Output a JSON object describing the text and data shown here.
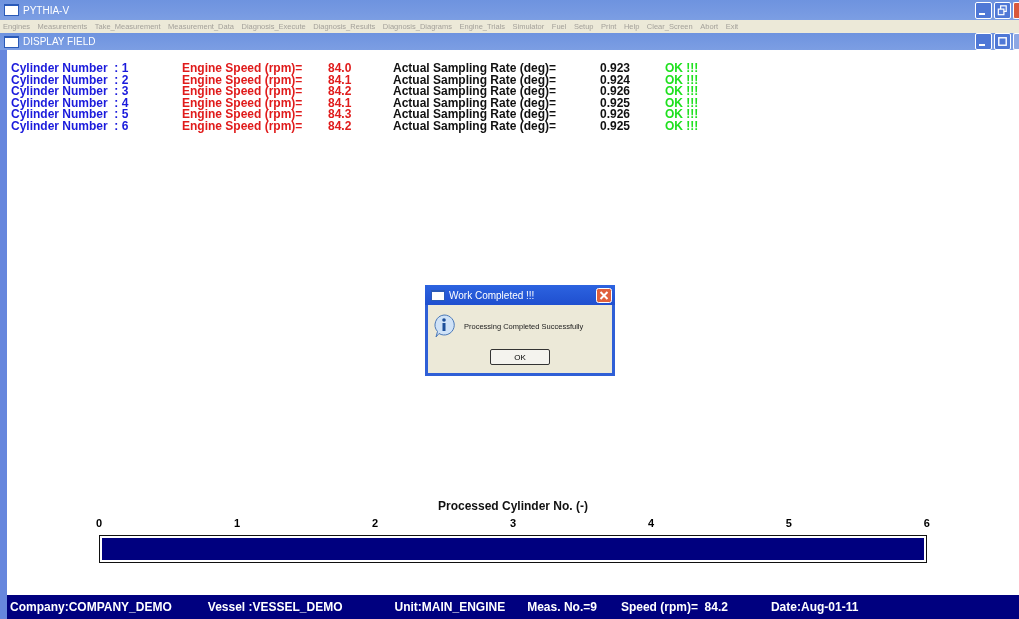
{
  "window": {
    "title": "PYTHIA-V"
  },
  "menu": [
    "Engines",
    "Measurements",
    "Take_Measurement",
    "Measurement_Data",
    "Diagnosis_Execute",
    "Diagnosis_Results",
    "Diagnosis_Diagrams",
    "Engine_Trials",
    "Simulator",
    "Fuel",
    "Setup",
    "Print",
    "Help",
    "Clear_Screen",
    "Abort",
    "Exit"
  ],
  "child_window": {
    "title": "DISPLAY FIELD"
  },
  "rows": [
    {
      "cylinder": "Cylinder Number  : 1",
      "speed_label": "Engine Speed (rpm)=",
      "speed": "84.0",
      "rate_label": "Actual Sampling Rate (deg)=",
      "rate": "0.923",
      "status": "OK !!!"
    },
    {
      "cylinder": "Cylinder Number  : 2",
      "speed_label": "Engine Speed (rpm)=",
      "speed": "84.1",
      "rate_label": "Actual Sampling Rate (deg)=",
      "rate": "0.924",
      "status": "OK !!!"
    },
    {
      "cylinder": "Cylinder Number  : 3",
      "speed_label": "Engine Speed (rpm)=",
      "speed": "84.2",
      "rate_label": "Actual Sampling Rate (deg)=",
      "rate": "0.926",
      "status": "OK !!!"
    },
    {
      "cylinder": "Cylinder Number  : 4",
      "speed_label": "Engine Speed (rpm)=",
      "speed": "84.1",
      "rate_label": "Actual Sampling Rate (deg)=",
      "rate": "0.925",
      "status": "OK !!!"
    },
    {
      "cylinder": "Cylinder Number  : 5",
      "speed_label": "Engine Speed (rpm)=",
      "speed": "84.3",
      "rate_label": "Actual Sampling Rate (deg)=",
      "rate": "0.926",
      "status": "OK !!!"
    },
    {
      "cylinder": "Cylinder Number  : 6",
      "speed_label": "Engine Speed (rpm)=",
      "speed": "84.2",
      "rate_label": "Actual Sampling Rate (deg)=",
      "rate": "0.925",
      "status": "OK !!!"
    }
  ],
  "dialog": {
    "title": "Work Completed !!!",
    "message": "Processing Completed Successfully",
    "button": "OK"
  },
  "progress": {
    "title": "Processed Cylinder No. (-)",
    "scale": [
      "0",
      "1",
      "2",
      "3",
      "4",
      "5",
      "6"
    ],
    "level": 1
  },
  "status_bar": [
    "Company:COMPANY_DEMO",
    "Vessel :VESSEL_DEMO",
    "Unit:MAIN_ENGINE",
    "Meas. No.=9",
    "Speed (rpm)=  84.2",
    "Date:Aug-01-11"
  ]
}
